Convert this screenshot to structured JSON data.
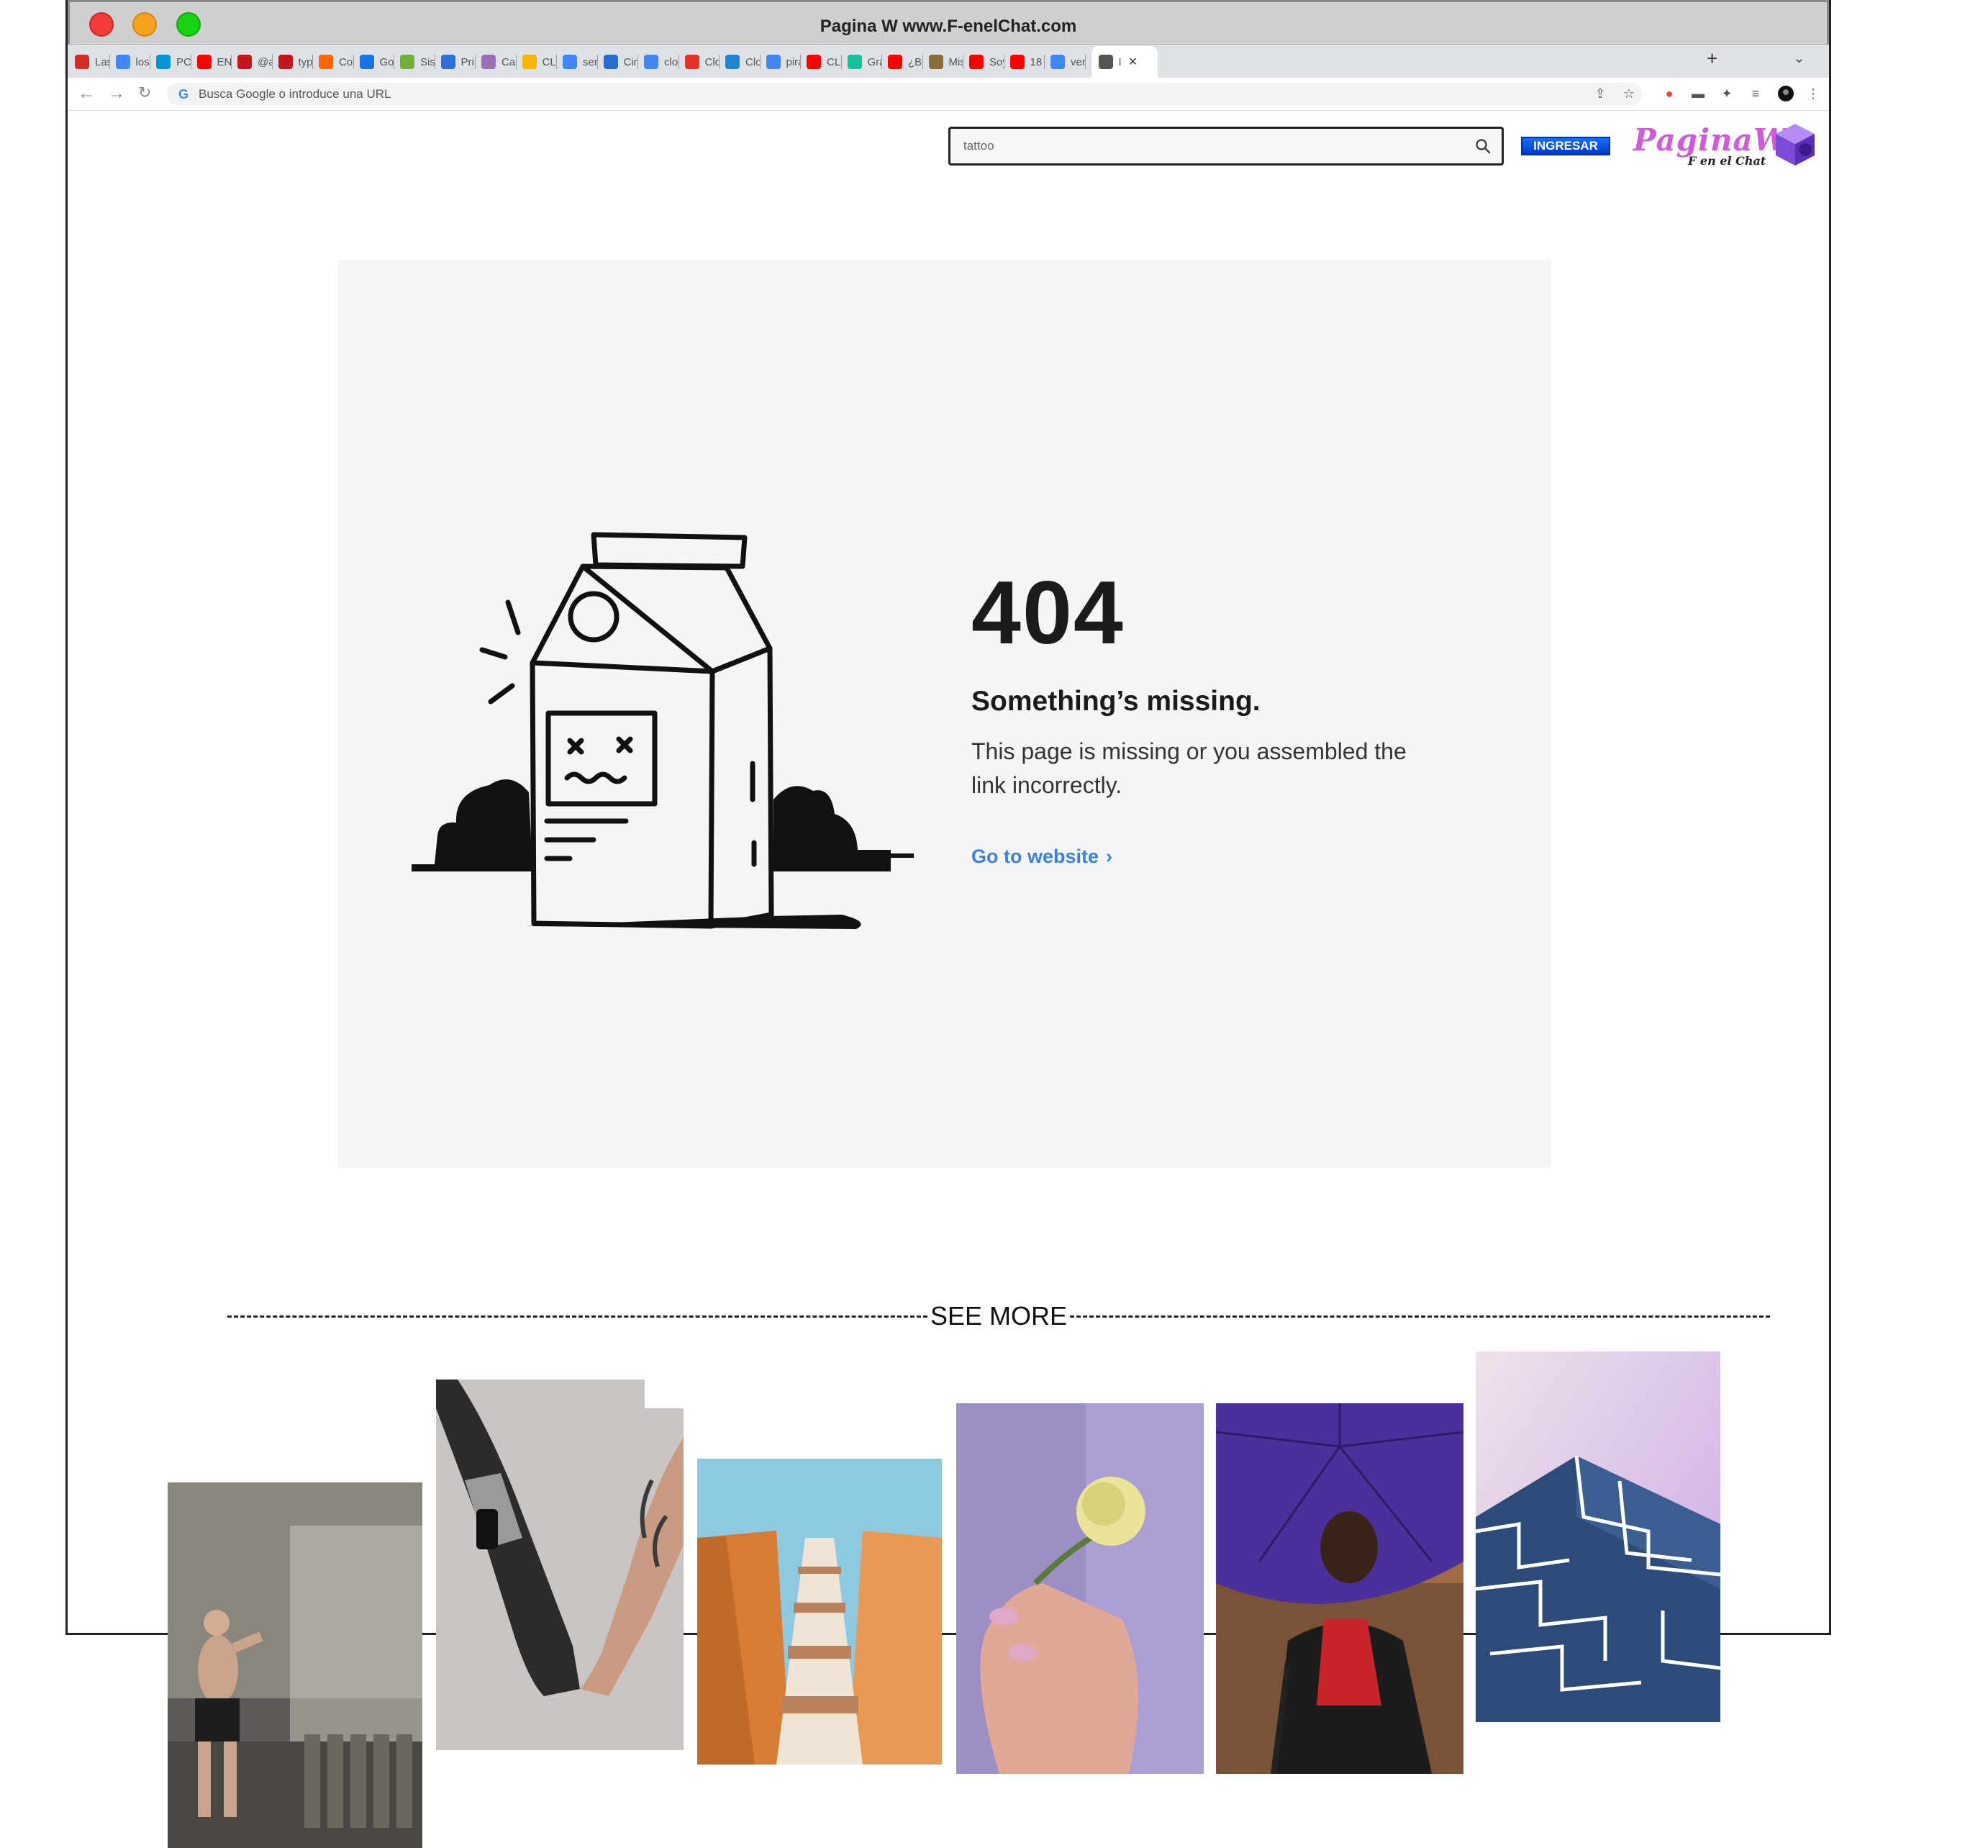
{
  "window": {
    "title": "Pagina W www.F-enelChat.com"
  },
  "tabs": [
    {
      "label": "Last",
      "favicon": "lastpass-icon",
      "color": "#d32d27"
    },
    {
      "label": "los r",
      "favicon": "google-icon",
      "color": "#4285f4"
    },
    {
      "label": "PC p",
      "favicon": "hp-icon",
      "color": "#0096d6"
    },
    {
      "label": "ENG",
      "favicon": "youtube-icon",
      "color": "#ff0000"
    },
    {
      "label": "@ar",
      "favicon": "news-icon",
      "color": "#c4161c"
    },
    {
      "label": "type",
      "favicon": "news-icon",
      "color": "#c4161c"
    },
    {
      "label": "Con",
      "favicon": "xiaomi-icon",
      "color": "#ff6700"
    },
    {
      "label": "Goo",
      "favicon": "calendar-icon",
      "color": "#1a73e8"
    },
    {
      "label": "Siste",
      "favicon": "system-icon",
      "color": "#6fb03a"
    },
    {
      "label": "Prin",
      "favicon": "print-icon",
      "color": "#2f6fd6"
    },
    {
      "label": "Cam",
      "favicon": "camera-icon",
      "color": "#9c6fb6"
    },
    {
      "label": "CLO",
      "favicon": "slides-icon",
      "color": "#f4b400"
    },
    {
      "label": "serv",
      "favicon": "google-icon",
      "color": "#4285f4"
    },
    {
      "label": "Cinc",
      "favicon": "s-icon",
      "color": "#2a6ad3"
    },
    {
      "label": "clou",
      "favicon": "google-icon",
      "color": "#4285f4"
    },
    {
      "label": "Clou",
      "favicon": "cloud-icon",
      "color": "#e6332a"
    },
    {
      "label": "Clou",
      "favicon": "cloud-icon",
      "color": "#2185d0"
    },
    {
      "label": "pira",
      "favicon": "google-icon",
      "color": "#4285f4"
    },
    {
      "label": "CLIP",
      "favicon": "youtube-icon",
      "color": "#ff0000"
    },
    {
      "label": "Grar",
      "favicon": "grammar-icon",
      "color": "#15c39a"
    },
    {
      "label": "¿Bus",
      "favicon": "youtube-icon",
      "color": "#ff0000"
    },
    {
      "label": "Misi",
      "favicon": "seal-icon",
      "color": "#8a6d3b"
    },
    {
      "label": "Soy",
      "favicon": "youtube-icon",
      "color": "#ff0000"
    },
    {
      "label": "18 H",
      "favicon": "youtube-icon",
      "color": "#ff0000"
    },
    {
      "label": "vent",
      "favicon": "google-icon",
      "color": "#4285f4"
    },
    {
      "label": "I",
      "favicon": "chrome-icon",
      "color": "#555555",
      "active": true
    }
  ],
  "omnibox": {
    "placeholder": "Busca Google o introduce una URL"
  },
  "header": {
    "search_value": "tattoo",
    "login_label": "INGRESAR",
    "brand_name": "PaginaW",
    "brand_sub": "F en el Chat"
  },
  "error": {
    "code": "404",
    "title": "Something’s missing.",
    "message": "This page is missing or you assembled the link incorrectly.",
    "link_label": "Go to website",
    "link_chevron": "›"
  },
  "see_more": {
    "label": "SEE MORE"
  },
  "gallery": [
    {
      "name": "gallery-image-boxer"
    },
    {
      "name": "gallery-image-robotic-hand"
    },
    {
      "name": "gallery-image-building-perspective"
    },
    {
      "name": "gallery-image-hand-flower"
    },
    {
      "name": "gallery-image-man-umbrella"
    },
    {
      "name": "gallery-image-glass-building"
    }
  ],
  "colors": {
    "accent_link": "#3b82e0",
    "login_button": "#1a6cff",
    "brand": "#d05ad8",
    "panel_bg": "#f4f5f7"
  }
}
